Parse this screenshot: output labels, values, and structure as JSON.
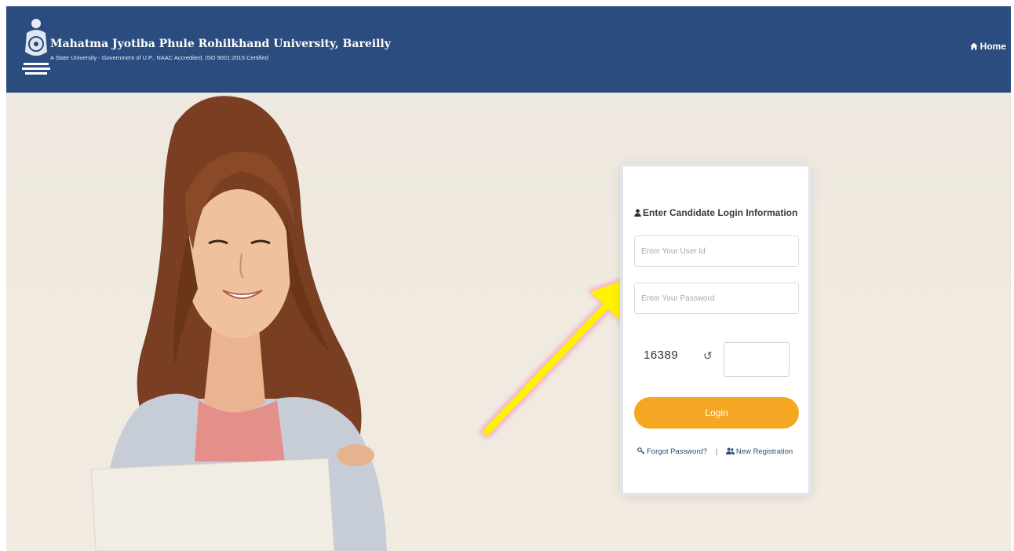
{
  "header": {
    "title": "Mahatma Jyotiba Phule Rohilkhand University, Bareilly",
    "subtitle": "A State University - Government of U.P., NAAC Accredited, ISO 9001:2015 Certified",
    "home_label": "Home",
    "bg_color": "#2b4c7e"
  },
  "login": {
    "title": "Enter Candidate Login Information",
    "user_placeholder": "Enter Your User Id",
    "password_placeholder": "Enter Your Password",
    "captcha_code": "16389",
    "refresh_symbol": "↺",
    "login_label": "Login",
    "forgot_label": "Forgot Password?",
    "separator": "|",
    "register_label": "New Registration",
    "button_color": "#f5a623"
  },
  "icons": {
    "home": "home-icon",
    "user": "user-icon",
    "key": "key-icon",
    "users": "users-icon",
    "refresh": "refresh-icon"
  },
  "annotation": {
    "arrow_color": "#fff200"
  }
}
